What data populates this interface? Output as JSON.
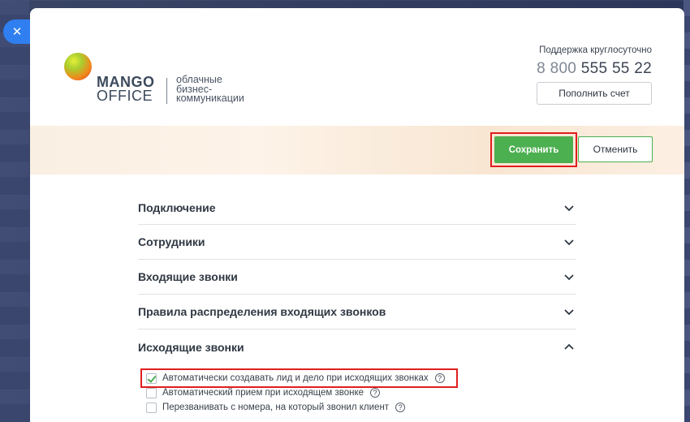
{
  "close_button": {
    "glyph": "✕"
  },
  "logo": {
    "word1": "MANGO",
    "word2": "OFFICE",
    "tagline_lines": [
      "облачные",
      "бизнес-",
      "коммуникации"
    ]
  },
  "support": {
    "label": "Поддержка круглосуточно",
    "phone_prefix": "8 800",
    "phone_number": "555 55 22",
    "topup_label": "Пополнить счет"
  },
  "actions": {
    "save_label": "Сохранить",
    "cancel_label": "Отменить"
  },
  "sections": [
    {
      "title": "Подключение",
      "expanded": false
    },
    {
      "title": "Сотрудники",
      "expanded": false
    },
    {
      "title": "Входящие звонки",
      "expanded": false
    },
    {
      "title": "Правила распределения входящих звонков",
      "expanded": false
    },
    {
      "title": "Исходящие звонки",
      "expanded": true
    }
  ],
  "outgoing_options": [
    {
      "label": "Автоматически создавать лид и дело при исходящих звонках",
      "checked": true,
      "help": "?"
    },
    {
      "label": "Автоматический прием при исходящем звонке",
      "checked": false,
      "help": "?"
    },
    {
      "label": "Перезванивать с номера, на который звонил клиент",
      "checked": false,
      "help": "?"
    }
  ],
  "colors": {
    "accent_green": "#4caf50",
    "highlight_red": "#e01e1e",
    "close_blue": "#2f7ff0"
  }
}
